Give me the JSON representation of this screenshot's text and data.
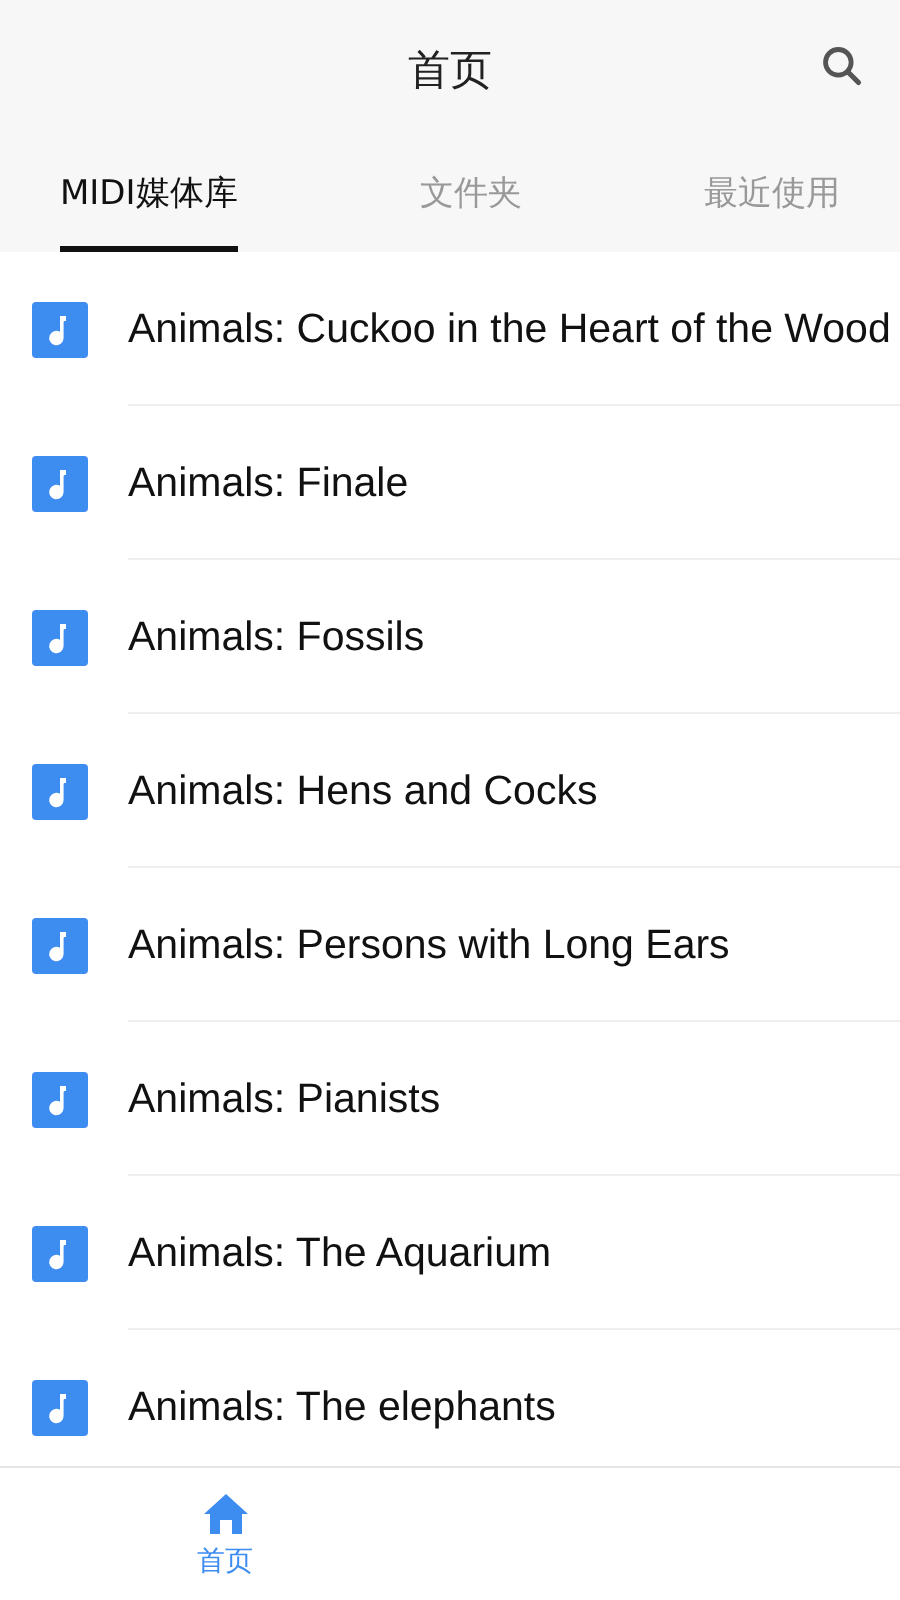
{
  "header": {
    "title": "首页"
  },
  "tabs": [
    {
      "label": "MIDI媒体库",
      "selected": true
    },
    {
      "label": "文件夹",
      "selected": false
    },
    {
      "label": "最近使用",
      "selected": false
    }
  ],
  "songs": [
    {
      "title": "Animals: Cuckoo in the Heart of the Wood"
    },
    {
      "title": "Animals: Finale"
    },
    {
      "title": "Animals: Fossils"
    },
    {
      "title": "Animals: Hens and Cocks"
    },
    {
      "title": "Animals: Persons with Long Ears"
    },
    {
      "title": "Animals: Pianists"
    },
    {
      "title": "Animals: The Aquarium"
    },
    {
      "title": "Animals: The elephants"
    }
  ],
  "bottom_nav": [
    {
      "label": "首页",
      "selected": true
    }
  ]
}
